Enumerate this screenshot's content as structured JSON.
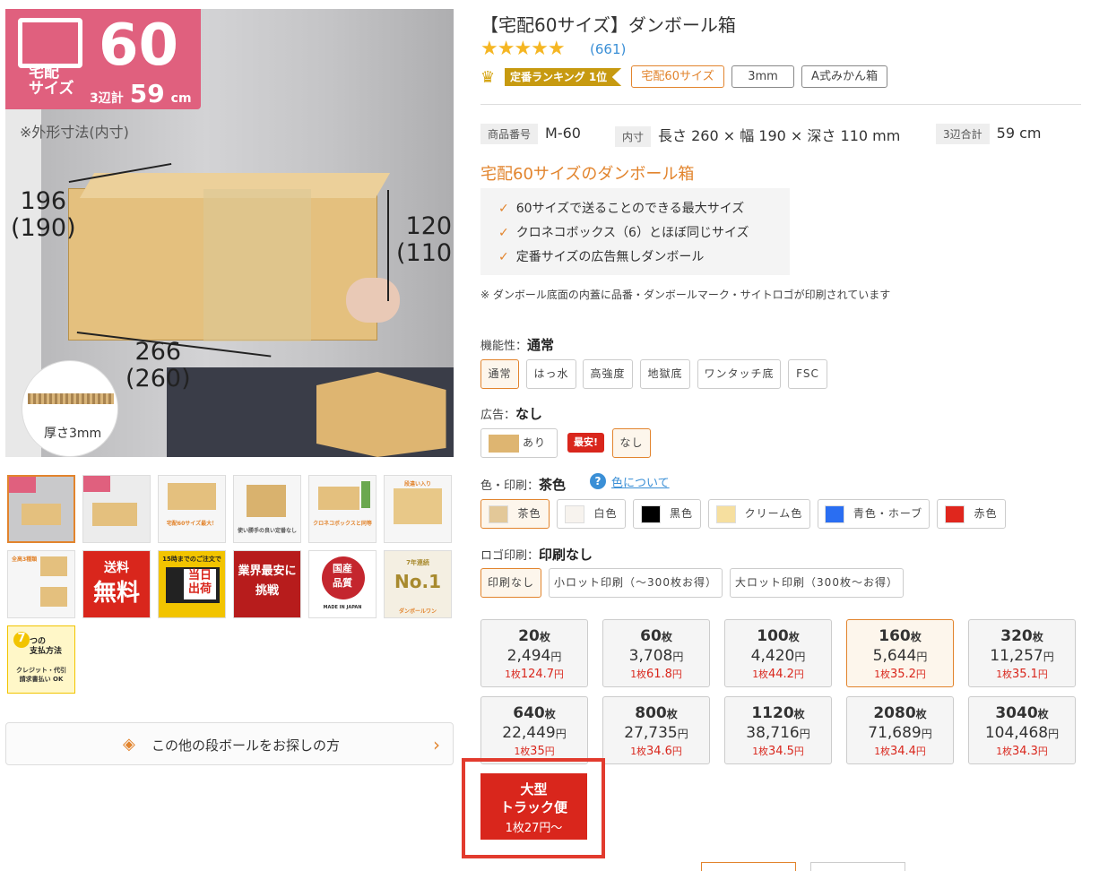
{
  "gallery": {
    "badge_delivery": "宅配\nサイズ",
    "badge_size": "60",
    "badge_total_label": "3辺計",
    "badge_total": "59",
    "badge_unit": "cm",
    "note": "※外形寸法(内寸)",
    "dim_depth": "196",
    "dim_depth_inner": "(190)",
    "dim_height": "120",
    "dim_height_inner": "(110)",
    "dim_width": "266",
    "dim_width_inner": "(260)",
    "thickness": "厚さ3mm",
    "thumbs": [
      {
        "label": "60"
      },
      {
        "label": "60"
      },
      {
        "label": "宅配60サイズ最大！"
      },
      {
        "label": "使い勝手の良い定番なし"
      },
      {
        "label": "クロネコボックスと同等"
      },
      {
        "label": "段違い入り"
      },
      {
        "label": "全高3種類"
      },
      {
        "label": "送料無料"
      },
      {
        "label": "当日出荷"
      },
      {
        "label": "業界最安に挑戦"
      },
      {
        "label": "国産品質"
      },
      {
        "label": "No.1"
      },
      {
        "label": "7つの支払方法"
      }
    ],
    "thumb_texts": {
      "free_top": "送料",
      "free_big": "無料",
      "sameday_top": "15時までのご注文で",
      "sameday_big": "当日\n出荷",
      "cheapest": "業界最安に\n挑戦",
      "domestic": "国産\n品質",
      "domestic_sub": "MADE IN JAPAN",
      "no1_top": "7年連続",
      "no1": "No.1",
      "no1_brand": "ダンボールワン",
      "pay_num": "7",
      "pay_title": "つの\n支払方法",
      "pay_sub": "クレジット・代引\n請求書払い OK"
    }
  },
  "search_other": "この他の段ボールをお探しの方",
  "product": {
    "title": "【宅配60サイズ】ダンボール箱",
    "stars": "★★★★★",
    "review_count": "(661)",
    "rank_label": "定番ランキング 1位",
    "tags": [
      "宅配60サイズ",
      "3mm",
      "A式みかん箱"
    ],
    "spec_code_label": "商品番号",
    "spec_code": "M-60",
    "spec_inner_label": "内寸",
    "spec_inner": "長さ 260 × 幅 190 × 深さ 110 mm",
    "spec_total_label": "3辺合計",
    "spec_total": "59 cm",
    "subtitle": "宅配60サイズのダンボール箱",
    "features": [
      "60サイズで送ることのできる最大サイズ",
      "クロネコボックス（6）とほぼ同じサイズ",
      "定番サイズの広告無しダンボール"
    ],
    "print_note": "※ ダンボール底面の内蓋に品番・ダンボールマーク・サイトロゴが印刷されています"
  },
  "options": {
    "function_label": "機能性：",
    "function_value": "通常",
    "function_items": [
      "通常",
      "はっ水",
      "高強度",
      "地獄底",
      "ワンタッチ底",
      "FSC"
    ],
    "ad_label": "広告：",
    "ad_value": "なし",
    "ad_items": [
      "あり",
      "なし"
    ],
    "ad_cheapest": "最安!",
    "color_label": "色・印刷：",
    "color_value": "茶色",
    "color_help": "色について",
    "colors": [
      {
        "name": "茶色",
        "hex": "#e3c898"
      },
      {
        "name": "白色",
        "hex": "#f7f3ee"
      },
      {
        "name": "黒色",
        "hex": "#000000"
      },
      {
        "name": "クリーム色",
        "hex": "#f6df9f"
      },
      {
        "name": "青色・ホーブ",
        "hex": "#2a6ef2"
      },
      {
        "name": "赤色",
        "hex": "#e0261d"
      }
    ],
    "logo_label": "ロゴ印刷：",
    "logo_value": "印刷なし",
    "logo_items": [
      "印刷なし",
      "小ロット印刷（〜300枚お得）",
      "大ロット印刷（300枚〜お得）"
    ]
  },
  "prices": [
    {
      "qty": "20",
      "price": "2,494",
      "unit_price": "124.7"
    },
    {
      "qty": "60",
      "price": "3,708",
      "unit_price": "61.8"
    },
    {
      "qty": "100",
      "price": "4,420",
      "unit_price": "44.2"
    },
    {
      "qty": "160",
      "price": "5,644",
      "unit_price": "35.2"
    },
    {
      "qty": "320",
      "price": "11,257",
      "unit_price": "35.1"
    },
    {
      "qty": "640",
      "price": "22,449",
      "unit_price": "35"
    },
    {
      "qty": "800",
      "price": "27,735",
      "unit_price": "34.6"
    },
    {
      "qty": "1120",
      "price": "38,716",
      "unit_price": "34.5"
    },
    {
      "qty": "2080",
      "price": "71,689",
      "unit_price": "34.4"
    },
    {
      "qty": "3040",
      "price": "104,468",
      "unit_price": "34.3"
    }
  ],
  "price_units": {
    "qty": "枚",
    "yen": "円",
    "per": "1枚"
  },
  "truck": {
    "line1": "大型",
    "line2": "トラック便",
    "price": "1枚27円〜"
  },
  "colors": {
    "accent": "#e2842d",
    "red": "#d9261c",
    "link": "#3a8fd6",
    "badge": "#e0607e"
  }
}
